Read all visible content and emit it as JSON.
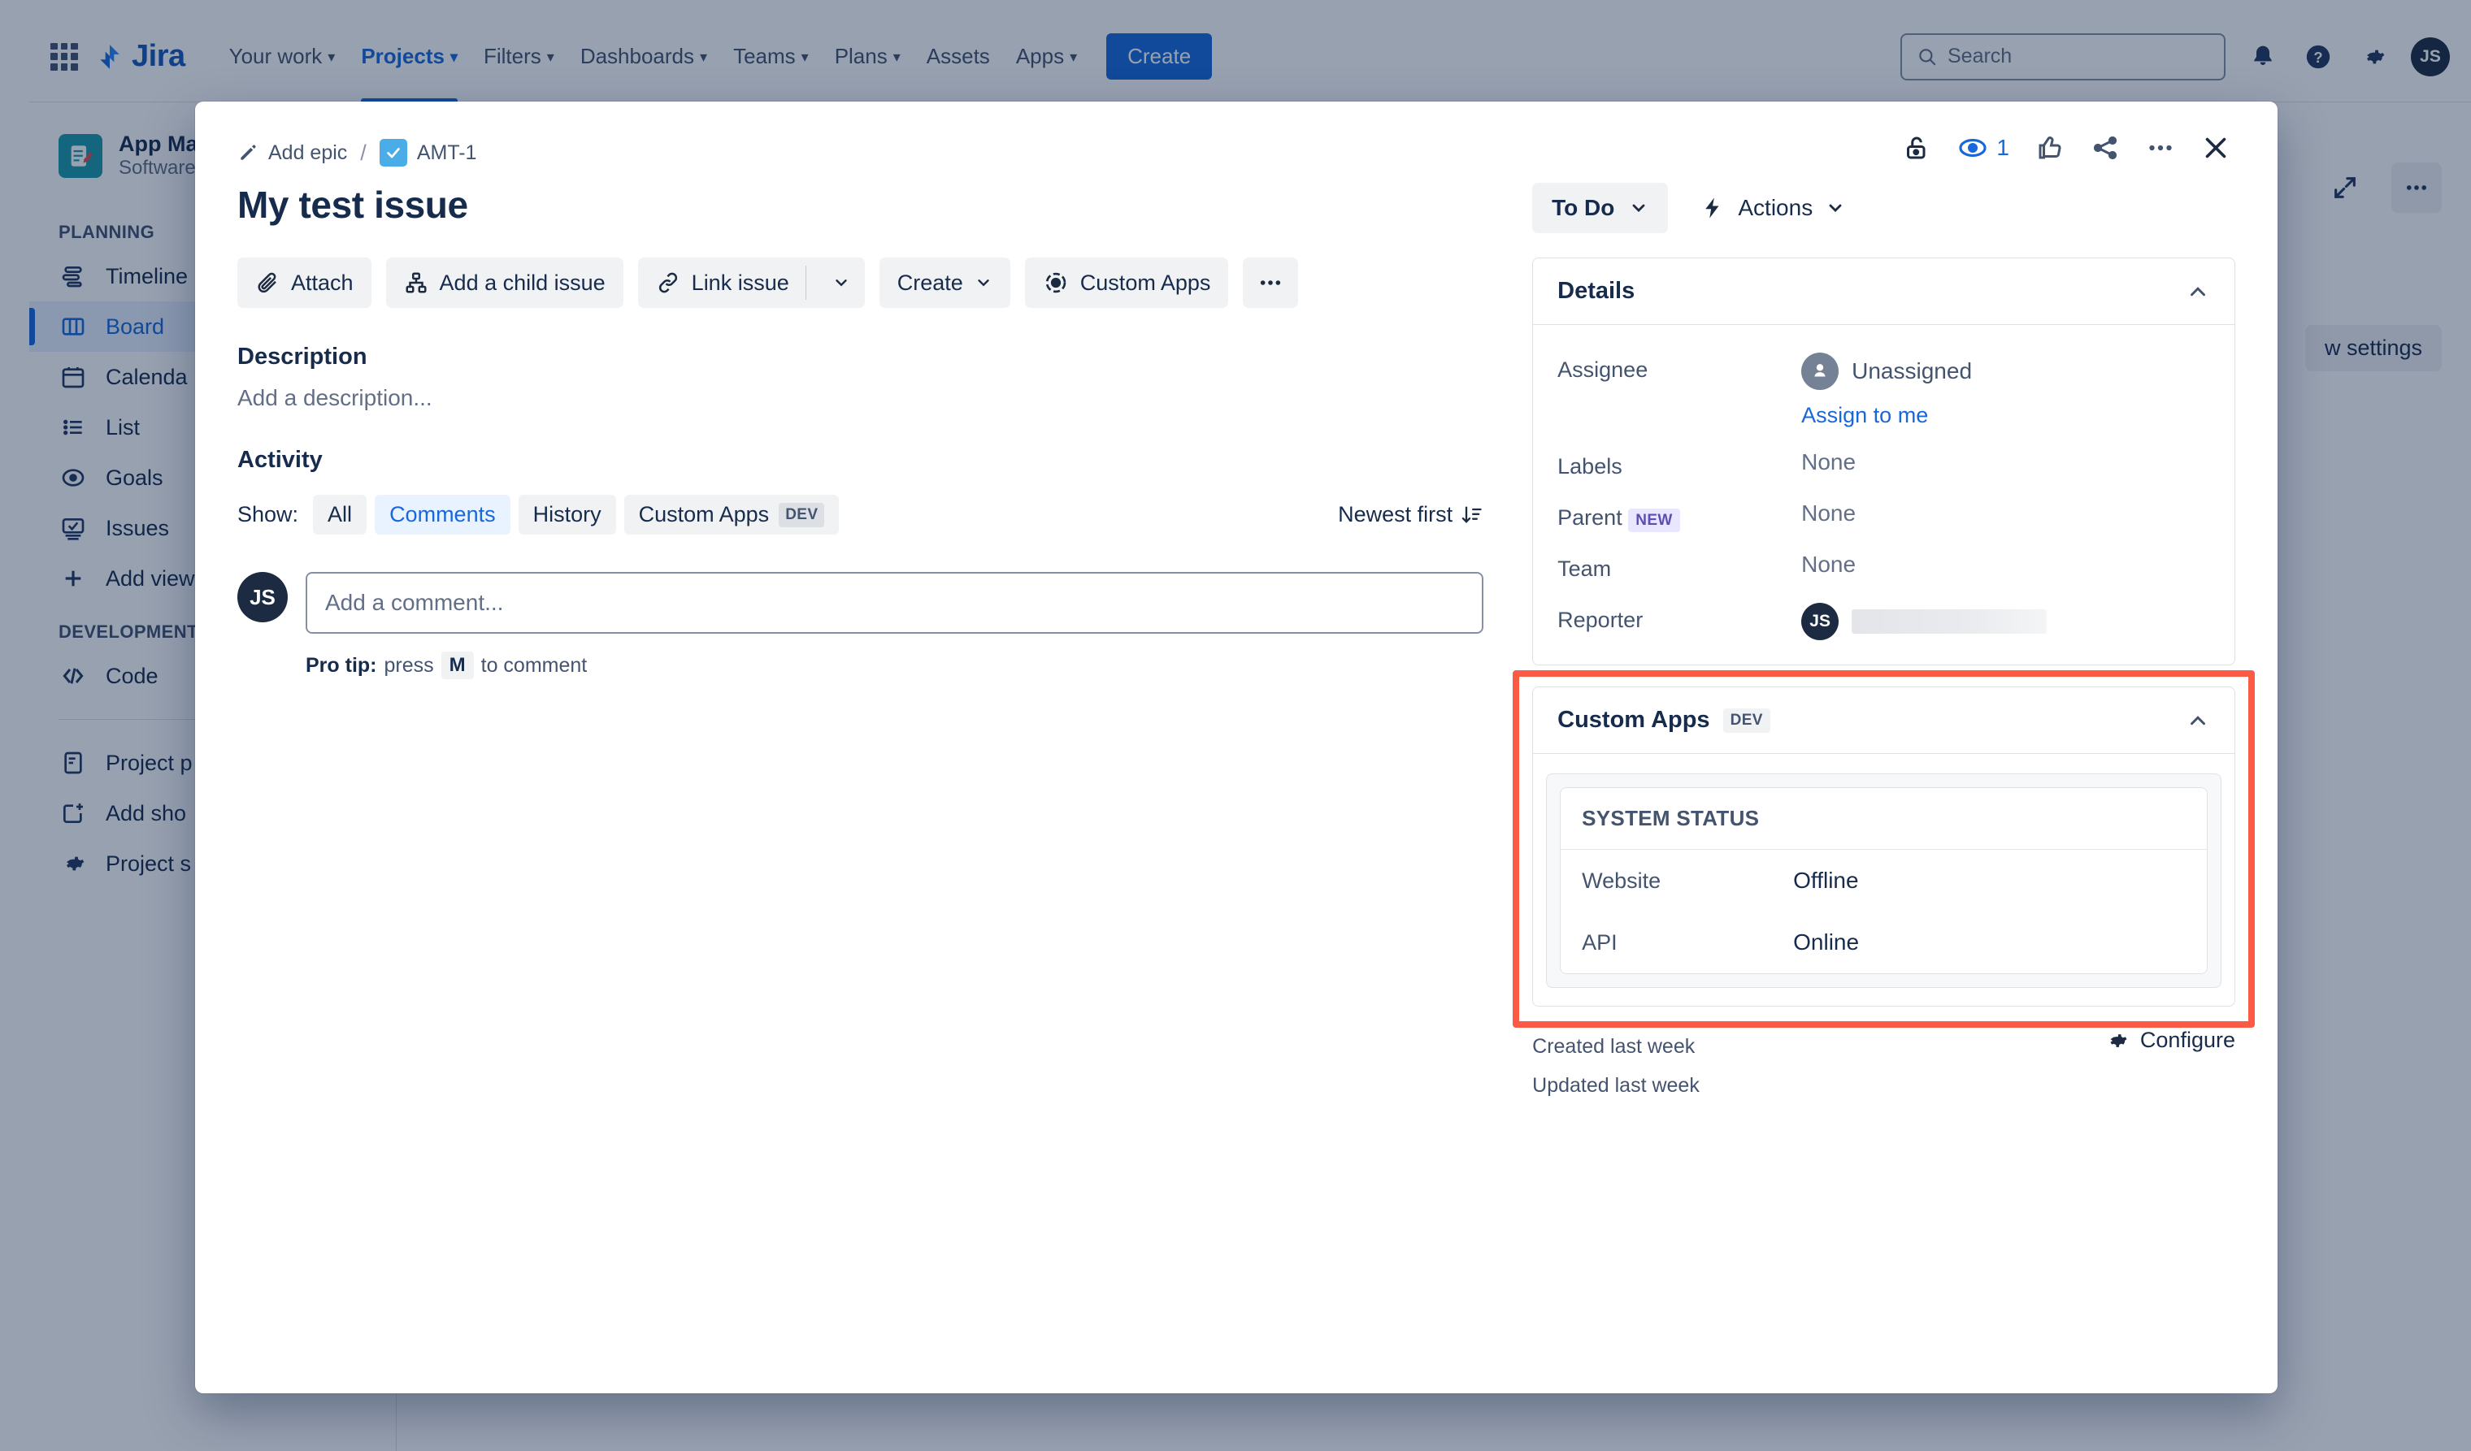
{
  "topnav": {
    "app_name": "Jira",
    "items": [
      {
        "label": "Your work",
        "has_caret": true,
        "active": false
      },
      {
        "label": "Projects",
        "has_caret": true,
        "active": true
      },
      {
        "label": "Filters",
        "has_caret": true,
        "active": false
      },
      {
        "label": "Dashboards",
        "has_caret": true,
        "active": false
      },
      {
        "label": "Teams",
        "has_caret": true,
        "active": false
      },
      {
        "label": "Plans",
        "has_caret": true,
        "active": false
      },
      {
        "label": "Assets",
        "has_caret": false,
        "active": false
      },
      {
        "label": "Apps",
        "has_caret": true,
        "active": false
      }
    ],
    "create_label": "Create",
    "search_placeholder": "Search",
    "avatar_initials": "JS"
  },
  "sidebar": {
    "project_name": "App Mak",
    "project_subtitle": "Software p",
    "sections": [
      {
        "label": "PLANNING",
        "items": [
          {
            "label": "Timeline",
            "icon": "timeline-icon",
            "selected": false
          },
          {
            "label": "Board",
            "icon": "board-icon",
            "selected": true
          },
          {
            "label": "Calenda",
            "icon": "calendar-icon",
            "selected": false
          },
          {
            "label": "List",
            "icon": "list-icon",
            "selected": false
          },
          {
            "label": "Goals",
            "icon": "goals-icon",
            "selected": false
          },
          {
            "label": "Issues",
            "icon": "issues-icon",
            "selected": false
          },
          {
            "label": "Add view",
            "icon": "plus-icon",
            "selected": false
          }
        ]
      },
      {
        "label": "DEVELOPMENT",
        "items": [
          {
            "label": "Code",
            "icon": "code-icon",
            "selected": false
          }
        ]
      }
    ],
    "footer_items": [
      {
        "label": "Project p",
        "icon": "page-icon"
      },
      {
        "label": "Add sho",
        "icon": "add-shortcut-icon"
      },
      {
        "label": "Project s",
        "icon": "gear-icon"
      }
    ]
  },
  "background": {
    "view_settings_label": "w settings"
  },
  "modal": {
    "breadcrumb": {
      "add_epic_label": "Add epic",
      "separator": "/",
      "issue_key": "AMT-1"
    },
    "header_actions": {
      "watch_count": "1"
    },
    "title": "My test issue",
    "action_buttons": [
      {
        "label": "Attach",
        "icon": "paperclip-icon",
        "has_caret": false
      },
      {
        "label": "Add a child issue",
        "icon": "child-issue-icon",
        "has_caret": false
      },
      {
        "label": "Link issue",
        "icon": "link-icon",
        "has_caret": true
      },
      {
        "label": "Create",
        "icon": "",
        "has_caret": true
      },
      {
        "label": "Custom Apps",
        "icon": "custom-apps-icon",
        "has_caret": false
      }
    ],
    "more_actions_label": "…",
    "description": {
      "heading": "Description",
      "placeholder": "Add a description..."
    },
    "activity": {
      "heading": "Activity",
      "show_label": "Show:",
      "filters": [
        {
          "label": "All",
          "active": false,
          "tag": ""
        },
        {
          "label": "Comments",
          "active": true,
          "tag": ""
        },
        {
          "label": "History",
          "active": false,
          "tag": ""
        },
        {
          "label": "Custom Apps",
          "active": false,
          "tag": "DEV"
        }
      ],
      "sort_label": "Newest first",
      "comment_avatar": "JS",
      "comment_placeholder": "Add a comment...",
      "protip_prefix": "Pro tip:",
      "protip_press": "press",
      "protip_key": "M",
      "protip_suffix": "to comment"
    },
    "right": {
      "status": "To Do",
      "actions_label": "Actions",
      "details_panel": {
        "title": "Details",
        "fields": [
          {
            "label": "Assignee",
            "value": "Unassigned",
            "type": "assignee",
            "link": "Assign to me"
          },
          {
            "label": "Labels",
            "value": "None",
            "type": "text"
          },
          {
            "label": "Parent",
            "value": "None",
            "type": "text",
            "tag": "NEW"
          },
          {
            "label": "Team",
            "value": "None",
            "type": "text"
          },
          {
            "label": "Reporter",
            "value": "",
            "type": "reporter",
            "avatar": "JS"
          }
        ]
      },
      "custom_apps_panel": {
        "title": "Custom Apps",
        "tag": "DEV",
        "card_title": "SYSTEM STATUS",
        "rows": [
          {
            "key": "Website",
            "value": "Offline"
          },
          {
            "key": "API",
            "value": "Online"
          }
        ],
        "highlight_color": "#fb5b44"
      },
      "meta": {
        "created": "Created last week",
        "updated": "Updated last week",
        "configure_label": "Configure"
      }
    }
  }
}
